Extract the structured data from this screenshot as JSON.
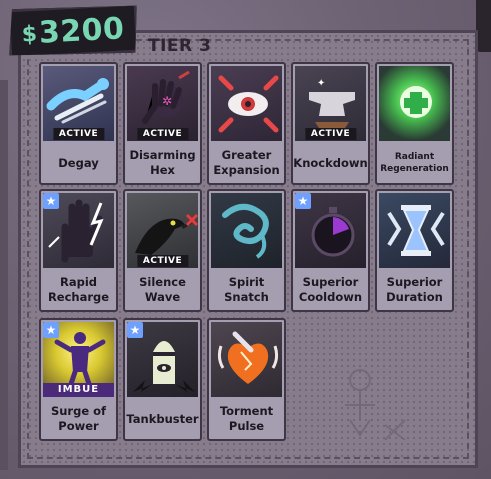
{
  "money": {
    "currency_symbol": "$",
    "amount": "3200"
  },
  "tier_label": "TIER 3",
  "badges": {
    "active": "ACTIVE",
    "imbue": "IMBUE"
  },
  "cards": [
    {
      "name": "Degay",
      "active": true,
      "starred": false,
      "icon": "bone-arm-icon"
    },
    {
      "name": "Disarming Hex",
      "active": true,
      "starred": false,
      "icon": "hex-hand-icon"
    },
    {
      "name": "Greater Expansion",
      "active": false,
      "starred": false,
      "icon": "expanding-eye-icon"
    },
    {
      "name": "Knockdown",
      "active": true,
      "starred": false,
      "icon": "anvil-icon"
    },
    {
      "name": "Radiant Regeneration",
      "active": false,
      "starred": false,
      "icon": "green-cross-icon"
    },
    {
      "name": "Rapid Recharge",
      "active": false,
      "starred": true,
      "icon": "lightning-hand-icon"
    },
    {
      "name": "Silence Wave",
      "active": true,
      "starred": false,
      "icon": "crow-icon"
    },
    {
      "name": "Spirit Snatch",
      "active": false,
      "starred": false,
      "icon": "spirit-swirl-icon"
    },
    {
      "name": "Superior Cooldown",
      "active": false,
      "starred": true,
      "icon": "stopwatch-icon"
    },
    {
      "name": "Superior Duration",
      "active": false,
      "starred": false,
      "icon": "hourglass-icon"
    },
    {
      "name": "Surge of Power",
      "active": false,
      "starred": true,
      "imbue": true,
      "icon": "power-figure-icon"
    },
    {
      "name": "Tankbuster",
      "active": false,
      "starred": true,
      "icon": "bomb-eye-icon"
    },
    {
      "name": "Torment Pulse",
      "active": false,
      "starred": false,
      "icon": "heart-pulse-icon"
    }
  ]
}
